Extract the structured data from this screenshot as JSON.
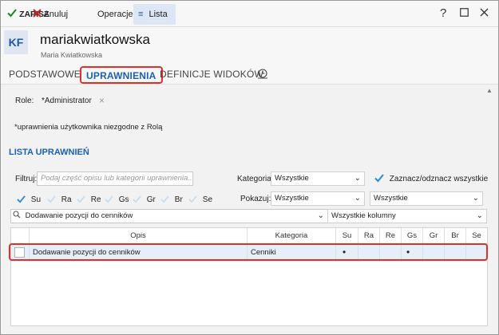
{
  "toolbar": {
    "save_label": "ZAPISZ",
    "cancel_label": "Anuluj",
    "operations_label": "Operacje",
    "list_label": "Lista",
    "help_label": "?"
  },
  "user": {
    "initials": "KF",
    "login": "mariakwiatkowska",
    "full_name": "Maria Kwiatkowska"
  },
  "tabs": [
    {
      "label": "PODSTAWOWE",
      "active": false
    },
    {
      "label": "UPRAWNIENIA",
      "active": true
    },
    {
      "label": "DEFINICJE WIDOKÓW",
      "active": false
    }
  ],
  "roles": {
    "label": "Role:",
    "value": "*Administrator"
  },
  "note": "*uprawnienia użytkownika niezgodne z Rolą",
  "section_title": "LISTA UPRAWNIEŃ",
  "filters": {
    "filter_label": "Filtruj:",
    "filter_placeholder": "Podaj część opisu lub kategorii uprawnienia...",
    "category_label": "Kategoria:",
    "category_value": "Wszystkie",
    "toggle_all_label": "Zaznacz/odznacz wszystkie",
    "show_label": "Pokazuj:",
    "show_value": "Wszystkie",
    "show_value2": "Wszystkie",
    "search_value": "Dodawanie pozycji do cenników",
    "columns_value": "Wszystkie kolumny"
  },
  "rights": [
    {
      "label": "Su",
      "checked": true
    },
    {
      "label": "Ra",
      "checked": false
    },
    {
      "label": "Re",
      "checked": false
    },
    {
      "label": "Gs",
      "checked": false
    },
    {
      "label": "Gr",
      "checked": false
    },
    {
      "label": "Br",
      "checked": false
    },
    {
      "label": "Se",
      "checked": false
    }
  ],
  "grid": {
    "columns": [
      "Opis",
      "Kategoria",
      "Su",
      "Ra",
      "Re",
      "Gs",
      "Gr",
      "Br",
      "Se"
    ],
    "rows": [
      {
        "opis": "Dodawanie pozycji do cenników",
        "kategoria": "Cenniki",
        "su": "•",
        "ra": "",
        "re": "",
        "gs": "•",
        "gr": "",
        "br": "",
        "se": ""
      }
    ]
  },
  "colors": {
    "accent": "#1a61b3",
    "highlight": "#e0302a",
    "save_green": "#1a7a1a",
    "cancel_red": "#d0201a"
  }
}
